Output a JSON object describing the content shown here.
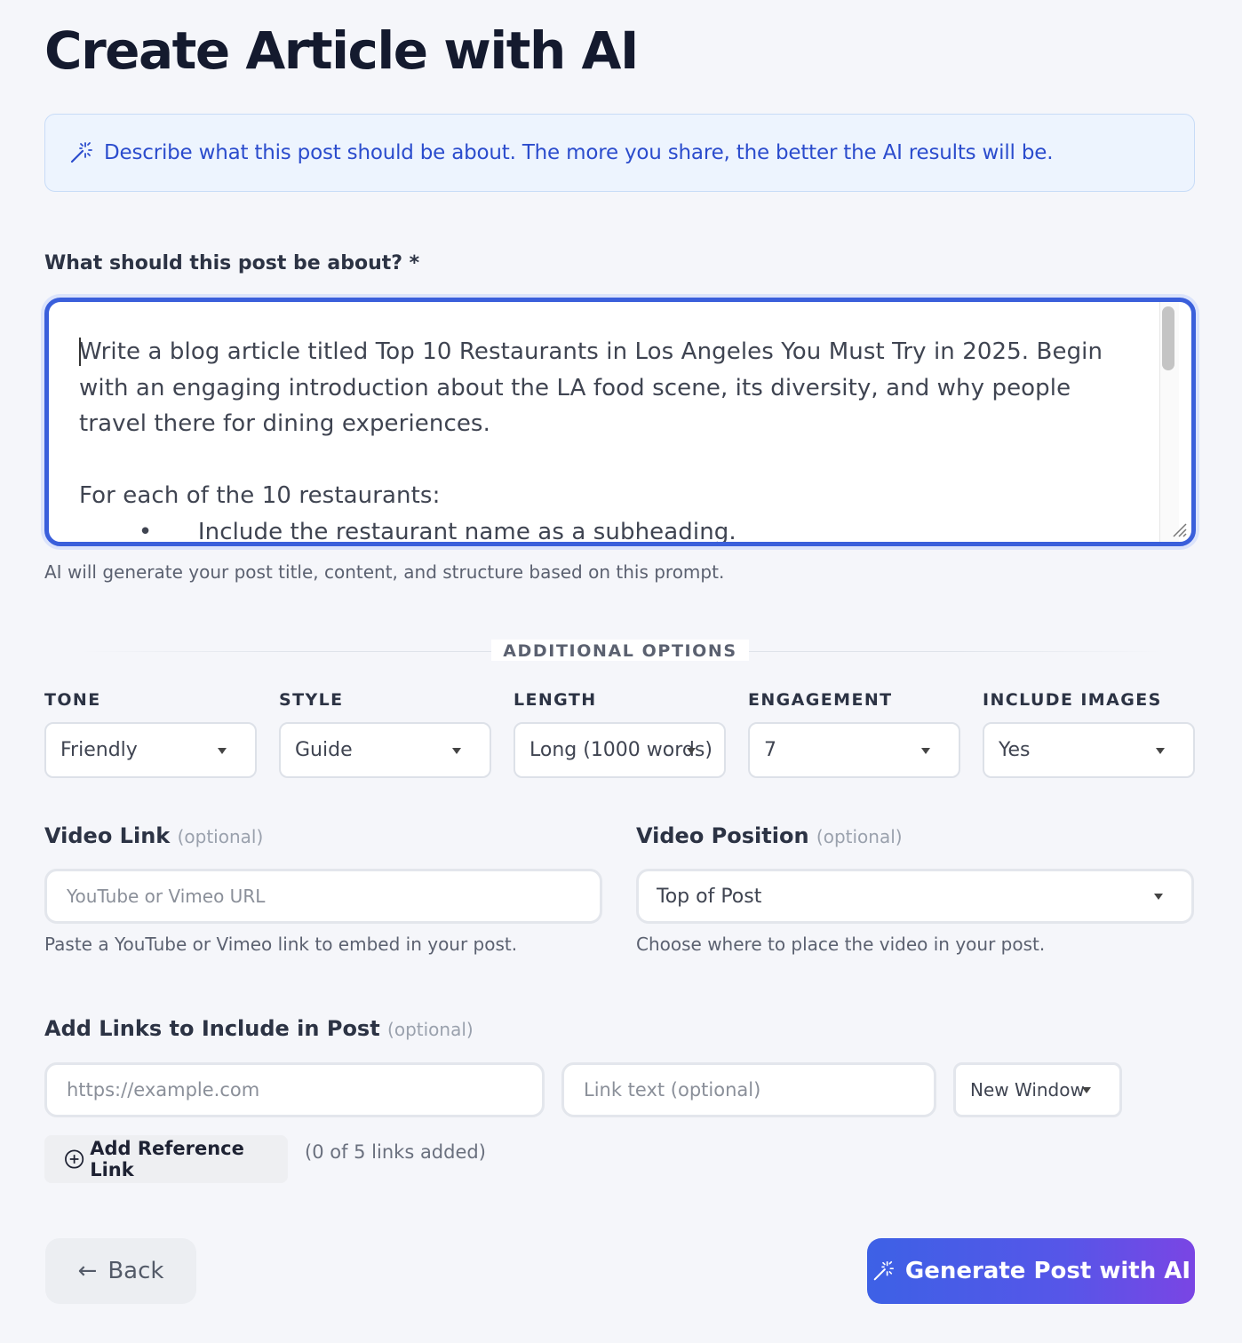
{
  "page": {
    "title": "Create Article with AI"
  },
  "info": {
    "text": "Describe what this post should be about. The more you share, the better the AI results will be.",
    "icon": "magic-wand-icon"
  },
  "prompt": {
    "label": "What should this post be about? *",
    "value": "Write a blog article titled Top 10 Restaurants in Los Angeles You Must Try in 2025. Begin with an engaging introduction about the LA food scene, its diversity, and why people travel there for dining experiences.\n\nFor each of the 10 restaurants:\n\t•\tInclude the restaurant name as a subheading.",
    "hint": "AI will generate your post title, content, and structure based on this prompt."
  },
  "additional_options": {
    "heading": "ADDITIONAL OPTIONS",
    "tone": {
      "label": "TONE",
      "value": "Friendly"
    },
    "style": {
      "label": "STYLE",
      "value": "Guide"
    },
    "length": {
      "label": "LENGTH",
      "value": "Long (1000 words)"
    },
    "engagement": {
      "label": "ENGAGEMENT",
      "value": "7"
    },
    "include_images": {
      "label": "INCLUDE IMAGES",
      "value": "Yes"
    }
  },
  "video_link": {
    "label": "Video Link",
    "optional": "(optional)",
    "placeholder": "YouTube or Vimeo URL",
    "hint": "Paste a YouTube or Vimeo link to embed in your post."
  },
  "video_position": {
    "label": "Video Position",
    "optional": "(optional)",
    "value": "Top of Post",
    "hint": "Choose where to place the video in your post."
  },
  "links": {
    "label": "Add Links to Include in Post",
    "optional": "(optional)",
    "url_placeholder": "https://example.com",
    "text_placeholder": "Link text (optional)",
    "target_value": "New Window",
    "add_button": "Add Reference Link",
    "count_text": "(0 of 5 links added)"
  },
  "footer": {
    "back_label": "Back",
    "generate_label": "Generate Post with AI"
  },
  "colors": {
    "accent": "#3a5fdb",
    "gradient_start": "#3d61e6",
    "gradient_end": "#7a45e4",
    "info_text": "#2b4ccd"
  }
}
